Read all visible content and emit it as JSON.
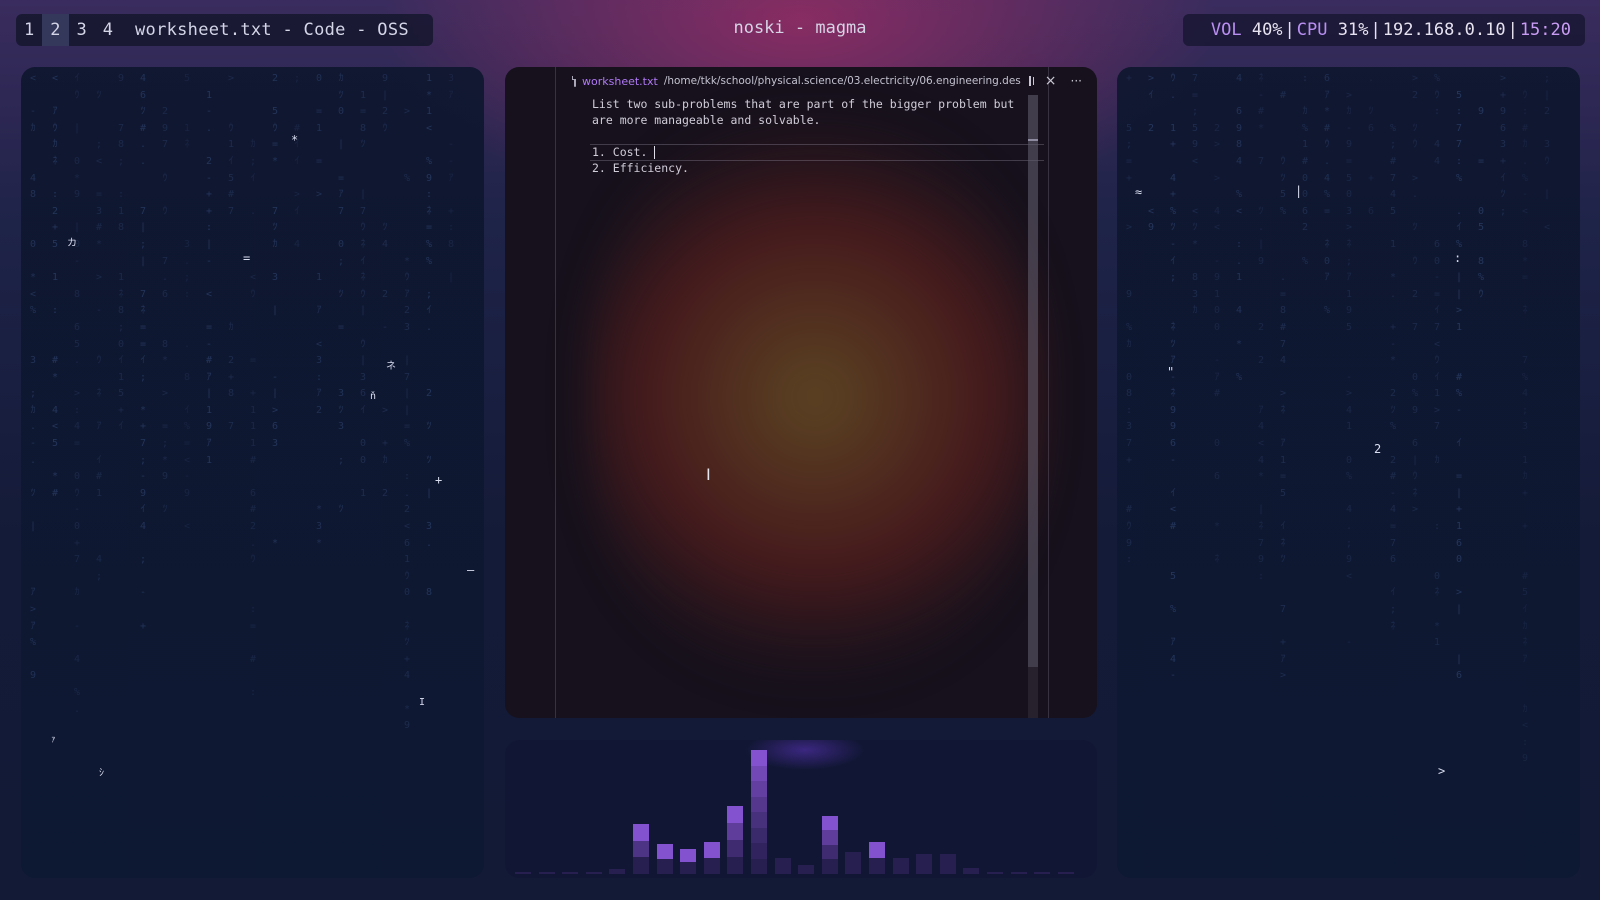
{
  "topbar": {
    "workspaces": [
      "1",
      "2",
      "3",
      "4"
    ],
    "active_workspace": "2",
    "window_title": "worksheet.txt - Code - OSS",
    "center_title": "noski - magma",
    "status": {
      "vol_label": "VOL",
      "vol_value": "40%",
      "cpu_label": "CPU",
      "cpu_value": "31%",
      "ip": "192.168.0.10",
      "time": "15:20",
      "separator": "|"
    }
  },
  "editor": {
    "tab_filename": "worksheet.txt",
    "tab_path": "/home/tkk/school/physical.science/03.electricity/06.engineering.des",
    "split_icon": "split-editor-icon",
    "close_icon": "×",
    "more_icon": "···",
    "lines": [
      "List two sub-problems that are part of the bigger problem but",
      "are more manageable and solvable.",
      "",
      "1. Cost. ",
      "2. Efficiency."
    ],
    "mouse_cursor": "I"
  },
  "left_panel": {
    "glyphs": [
      "*",
      "カ",
      "=",
      "ネ",
      "ň",
      "+",
      "–",
      "I",
      "ｧ",
      "ｼ"
    ]
  },
  "right_panel": {
    "glyphs": [
      "≈",
      "|",
      ":",
      "\"",
      "2",
      ">"
    ]
  },
  "visualizer": {
    "levels": [
      0.02,
      0.02,
      0.02,
      0.02,
      0.04,
      0.4,
      0.24,
      0.2,
      0.26,
      0.55,
      1.0,
      0.13,
      0.07,
      0.47,
      0.18,
      0.26,
      0.13,
      0.16,
      0.16,
      0.05,
      0.02,
      0.02,
      0.02,
      0.02
    ],
    "colors": {
      "bar_low": "#3b2a6a",
      "bar_high": "#8a55d8"
    }
  },
  "colors": {
    "accent_purple": "#b98ff2",
    "tab_name": "#b07af5"
  }
}
